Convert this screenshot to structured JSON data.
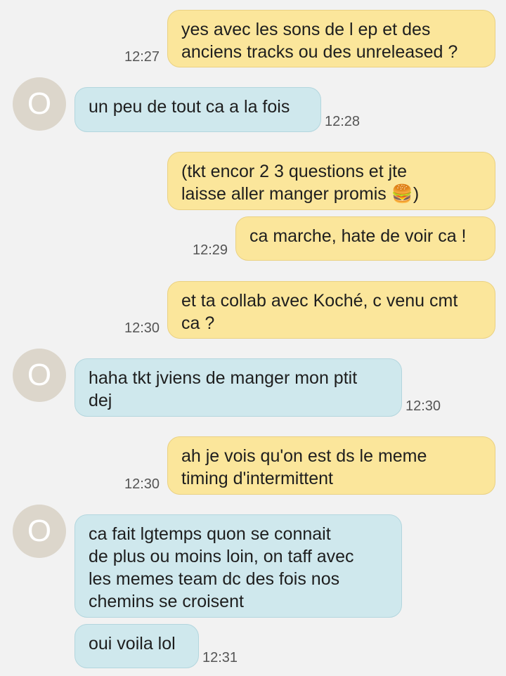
{
  "contact": {
    "avatar_initial": "O"
  },
  "messages": [
    {
      "direction": "outgoing",
      "lines": [
        "yes avec les sons de l ep et des",
        "anciens tracks ou des unreleased ?"
      ],
      "time": "12:27"
    },
    {
      "direction": "incoming",
      "lines": [
        "un peu de tout ca a la fois"
      ],
      "time": "12:28"
    },
    {
      "direction": "outgoing",
      "lines": [
        "(tkt encor 2 3 questions et jte",
        "laisse aller manger promis 🍔)"
      ],
      "time": ""
    },
    {
      "direction": "outgoing",
      "lines": [
        "ca marche, hate de voir ca !"
      ],
      "time": "12:29"
    },
    {
      "direction": "outgoing",
      "lines": [
        "et ta collab avec Koché, c venu cmt",
        "ca ?"
      ],
      "time": "12:30"
    },
    {
      "direction": "incoming",
      "lines": [
        "haha tkt jviens de manger mon ptit",
        "dej"
      ],
      "time": "12:30"
    },
    {
      "direction": "outgoing",
      "lines": [
        "ah je vois qu'on est ds le meme",
        "timing d'intermittent"
      ],
      "time": "12:30"
    },
    {
      "direction": "incoming",
      "lines": [
        "ca fait lgtemps quon se connait",
        "de plus ou moins loin, on taff avec",
        "les memes team dc des fois nos",
        "chemins se croisent"
      ],
      "time": ""
    },
    {
      "direction": "incoming",
      "lines": [
        "oui voila lol"
      ],
      "time": "12:31"
    }
  ]
}
